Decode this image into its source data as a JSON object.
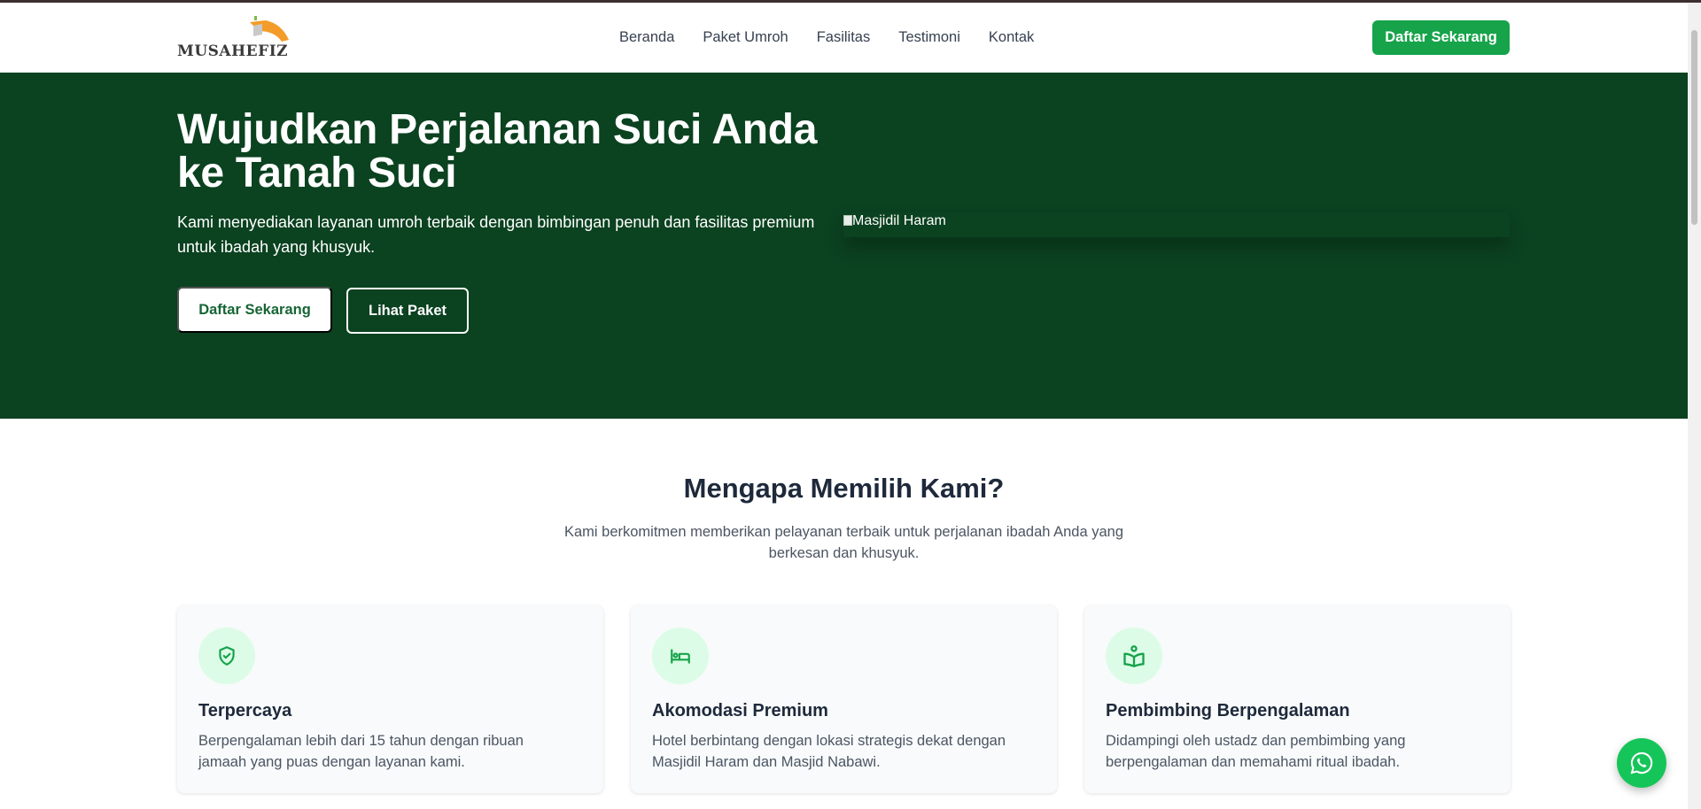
{
  "brand": {
    "logo_text": "MUSAHEFIZ"
  },
  "nav": {
    "items": [
      {
        "label": "Beranda"
      },
      {
        "label": "Paket Umroh"
      },
      {
        "label": "Fasilitas"
      },
      {
        "label": "Testimoni"
      },
      {
        "label": "Kontak"
      }
    ],
    "cta_label": "Daftar Sekarang"
  },
  "hero": {
    "title": "Wujudkan Perjalanan Suci Anda ke Tanah Suci",
    "subtitle": "Kami menyediakan layanan umroh terbaik dengan bimbingan penuh dan fasilitas premium untuk ibadah yang khusyuk.",
    "primary_button": "Daftar Sekarang",
    "secondary_button": "Lihat Paket",
    "image_alt": "Masjidil Haram"
  },
  "why": {
    "title": "Mengapa Memilih Kami?",
    "subtitle": "Kami berkomitmen memberikan pelayanan terbaik untuk perjalanan ibadah Anda yang berkesan dan khusyuk.",
    "cards": [
      {
        "icon": "shield-check-icon",
        "title": "Terpercaya",
        "text": "Berpengalaman lebih dari 15 tahun dengan ribuan jamaah yang puas dengan layanan kami."
      },
      {
        "icon": "bed-icon",
        "title": "Akomodasi Premium",
        "text": "Hotel berbintang dengan lokasi strategis dekat dengan Masjidil Haram dan Masjid Nabawi."
      },
      {
        "icon": "book-reader-icon",
        "title": "Pembimbing Berpengalaman",
        "text": "Didampingi oleh ustadz dan pembimbing yang berpengalaman dan memahami ritual ibadah."
      }
    ]
  },
  "colors": {
    "hero_bg": "#0b4220",
    "accent_green": "#16a34a",
    "icon_circle_bg": "#dcfce7",
    "whatsapp_green": "#16c55a"
  },
  "floating": {
    "icon": "whatsapp-icon"
  }
}
